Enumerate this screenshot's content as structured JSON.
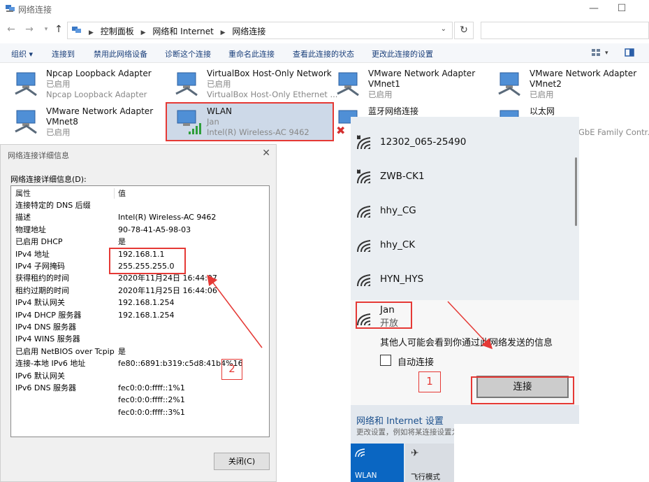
{
  "window": {
    "title": "网络连接",
    "minimize": "—",
    "maximize": "☐"
  },
  "address": {
    "crumbs": [
      "控制面板",
      "网络和 Internet",
      "网络连接"
    ]
  },
  "toolbar": {
    "organize": "组织 ▾",
    "connect_to": "连接到",
    "disable": "禁用此网络设备",
    "diagnose": "诊断这个连接",
    "rename": "重命名此连接",
    "view_status": "查看此连接的状态",
    "change_settings": "更改此连接的设置"
  },
  "adapters": [
    {
      "name": "Npcap Loopback Adapter",
      "status": "已启用",
      "device": "Npcap Loopback Adapter"
    },
    {
      "name": "VirtualBox Host-Only Network",
      "status": "已启用",
      "device": "VirtualBox Host-Only Ethernet ..."
    },
    {
      "name": "VMware Network Adapter",
      "status": "VMnet1",
      "device": "已启用"
    },
    {
      "name": "VMware Network Adapter",
      "status": "VMnet2",
      "device": "已启用"
    },
    {
      "name": "VMware Network Adapter",
      "status": "VMnet8",
      "device": "已启用"
    },
    {
      "name": "WLAN",
      "status": "Jan",
      "device": "Intel(R) Wireless-AC 9462"
    },
    {
      "name": "蓝牙网络连接",
      "status": "",
      "device": ""
    },
    {
      "name": "以太网",
      "status": "",
      "device": "GbE Family Contr..."
    }
  ],
  "dialog": {
    "title": "网络连接详细信息",
    "list_label": "网络连接详细信息(D):",
    "header": {
      "key": "属性",
      "value": "值"
    },
    "rows": [
      {
        "key": "连接特定的 DNS 后缀",
        "value": ""
      },
      {
        "key": "描述",
        "value": "Intel(R) Wireless-AC 9462"
      },
      {
        "key": "物理地址",
        "value": "90-78-41-A5-98-03"
      },
      {
        "key": "已启用 DHCP",
        "value": "是"
      },
      {
        "key": "IPv4 地址",
        "value": "192.168.1.1"
      },
      {
        "key": "IPv4 子网掩码",
        "value": "255.255.255.0"
      },
      {
        "key": "获得租约的时间",
        "value": "2020年11月24日 16:44:07"
      },
      {
        "key": "租约过期的时间",
        "value": "2020年11月25日 16:44:06"
      },
      {
        "key": "IPv4 默认网关",
        "value": "192.168.1.254"
      },
      {
        "key": "IPv4 DHCP 服务器",
        "value": "192.168.1.254"
      },
      {
        "key": "IPv4 DNS 服务器",
        "value": ""
      },
      {
        "key": "IPv4 WINS 服务器",
        "value": ""
      },
      {
        "key": "已启用 NetBIOS over Tcpip",
        "value": "是"
      },
      {
        "key": "连接-本地 IPv6 地址",
        "value": "fe80::6891:b319:c5d8:41b4%16"
      },
      {
        "key": "IPv6 默认网关",
        "value": ""
      },
      {
        "key": "IPv6 DNS 服务器",
        "value": "fec0:0:0:ffff::1%1"
      },
      {
        "key": "",
        "value": "fec0:0:0:ffff::2%1"
      },
      {
        "key": "",
        "value": "fec0:0:0:ffff::3%1"
      }
    ],
    "close_button": "关闭(C)",
    "annotation": "2"
  },
  "wifi": {
    "networks": [
      {
        "name": "12302_065-25490",
        "secured": true
      },
      {
        "name": "ZWB-CK1",
        "secured": true
      },
      {
        "name": "hhy_CG",
        "secured": false
      },
      {
        "name": "hhy_CK",
        "secured": false
      },
      {
        "name": "HYN_HYS",
        "secured": false
      }
    ],
    "selected": {
      "name": "Jan",
      "state": "开放",
      "warning": "其他人可能会看到你通过此网络发送的信息",
      "auto_connect": "自动连接",
      "connect": "连接"
    },
    "annotation": "1",
    "settings_title": "网络和 Internet 设置",
    "settings_sub": "更改设置，例如将某连接设置为按流量计费。",
    "tile_wlan": "WLAN",
    "tile_airplane": "飞行模式"
  },
  "colors": {
    "accent": "#0a66c2",
    "annotation": "#e53935",
    "selection": "#cdd9e8"
  }
}
